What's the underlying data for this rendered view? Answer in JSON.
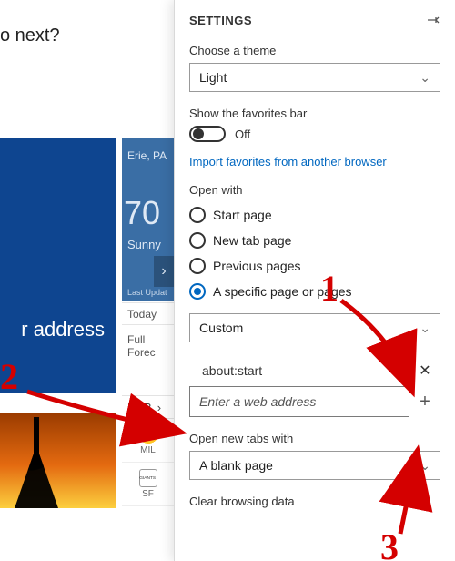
{
  "background": {
    "question_suffix": "o next?",
    "weather": {
      "location": "Erie, PA",
      "temp": "70",
      "condition": "Sunny",
      "last_update": "Last Updat"
    },
    "rows": {
      "today": "Today",
      "full_forecast": "Full Forec"
    },
    "address_label": "r address",
    "scores": {
      "league": "MLB",
      "chev": "›",
      "team1": "MIL",
      "team2": "SF"
    }
  },
  "settings": {
    "title": "SETTINGS",
    "theme": {
      "label": "Choose a theme",
      "value": "Light"
    },
    "favorites": {
      "label": "Show the favorites bar",
      "state": "Off"
    },
    "import_link": "Import favorites from another browser",
    "open_with": {
      "label": "Open with",
      "options": [
        "Start page",
        "New tab page",
        "Previous pages",
        "A specific page or pages"
      ],
      "selected_index": 3,
      "custom_label": "Custom",
      "existing_page": "about:start",
      "input_placeholder": "Enter a web address"
    },
    "new_tabs": {
      "label": "Open new tabs with",
      "value": "A blank page"
    },
    "clear_label": "Clear browsing data"
  },
  "annotations": {
    "n1": "1",
    "n2": "2",
    "n3": "3"
  },
  "icons": {
    "chevron_down": "⌄",
    "chevron_right": "›",
    "close": "✕",
    "plus": "+"
  }
}
